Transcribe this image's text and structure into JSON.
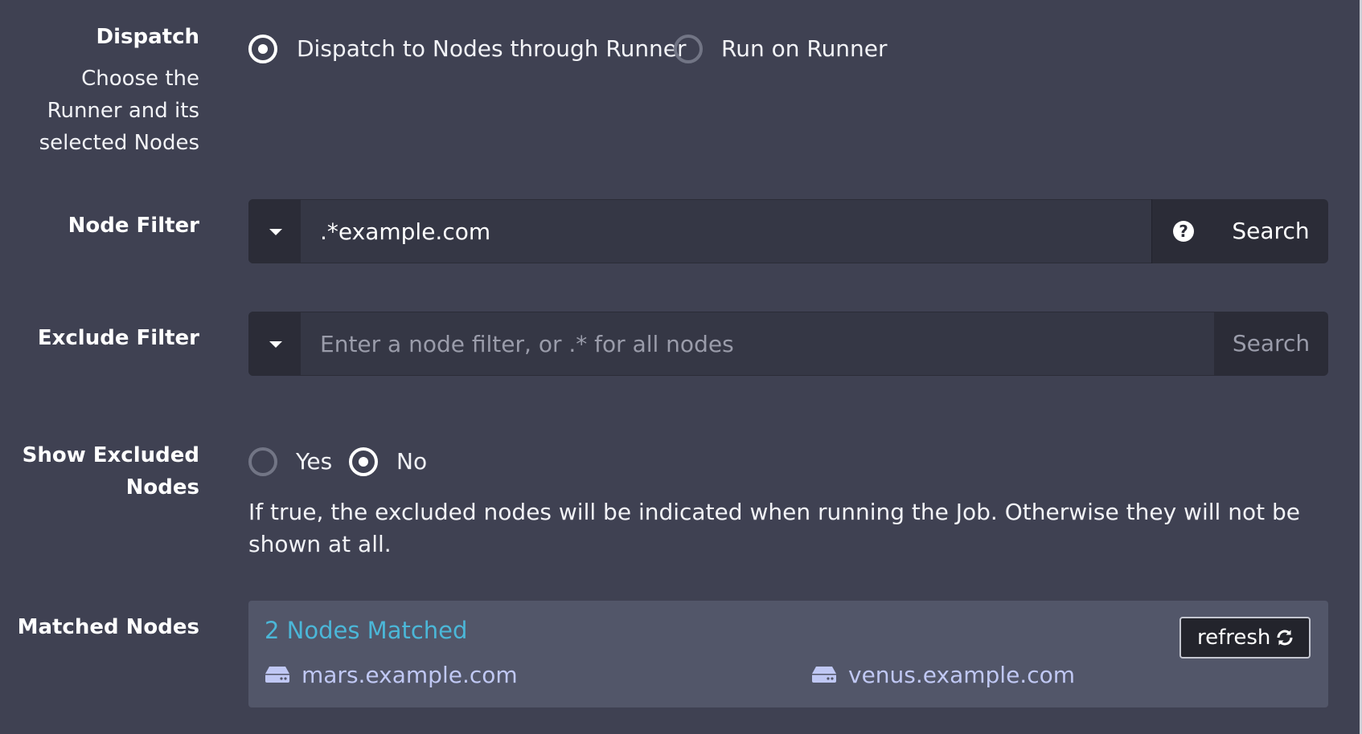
{
  "dispatch": {
    "label": "Dispatch",
    "help": "Choose the Runner and its selected Nodes",
    "options": [
      {
        "label": "Dispatch to Nodes through Runner",
        "checked": true
      },
      {
        "label": "Run on Runner",
        "checked": false
      }
    ]
  },
  "node_filter": {
    "label": "Node Filter",
    "value": ".*example.com",
    "help_icon": "question-circle-icon",
    "search_label": "Search"
  },
  "exclude_filter": {
    "label": "Exclude Filter",
    "placeholder": "Enter a node filter, or .* for all nodes",
    "search_label": "Search"
  },
  "show_excluded": {
    "label": "Show Excluded Nodes",
    "options": [
      {
        "label": "Yes",
        "checked": false
      },
      {
        "label": "No",
        "checked": true
      }
    ],
    "description": "If true, the excluded nodes will be indicated when running the Job. Otherwise they will not be shown at all."
  },
  "matched_nodes": {
    "label": "Matched Nodes",
    "count_text": "2 Nodes Matched",
    "refresh_label": "refresh",
    "refresh_icon": "refresh-icon",
    "node_icon": "server-icon",
    "nodes": [
      "mars.example.com",
      "venus.example.com"
    ]
  },
  "colors": {
    "background": "#3f4152",
    "accent": "#4bb7d8",
    "node_text": "#c0c8f4",
    "input_group": "#2b2c37",
    "matched_panel": "#525669"
  }
}
